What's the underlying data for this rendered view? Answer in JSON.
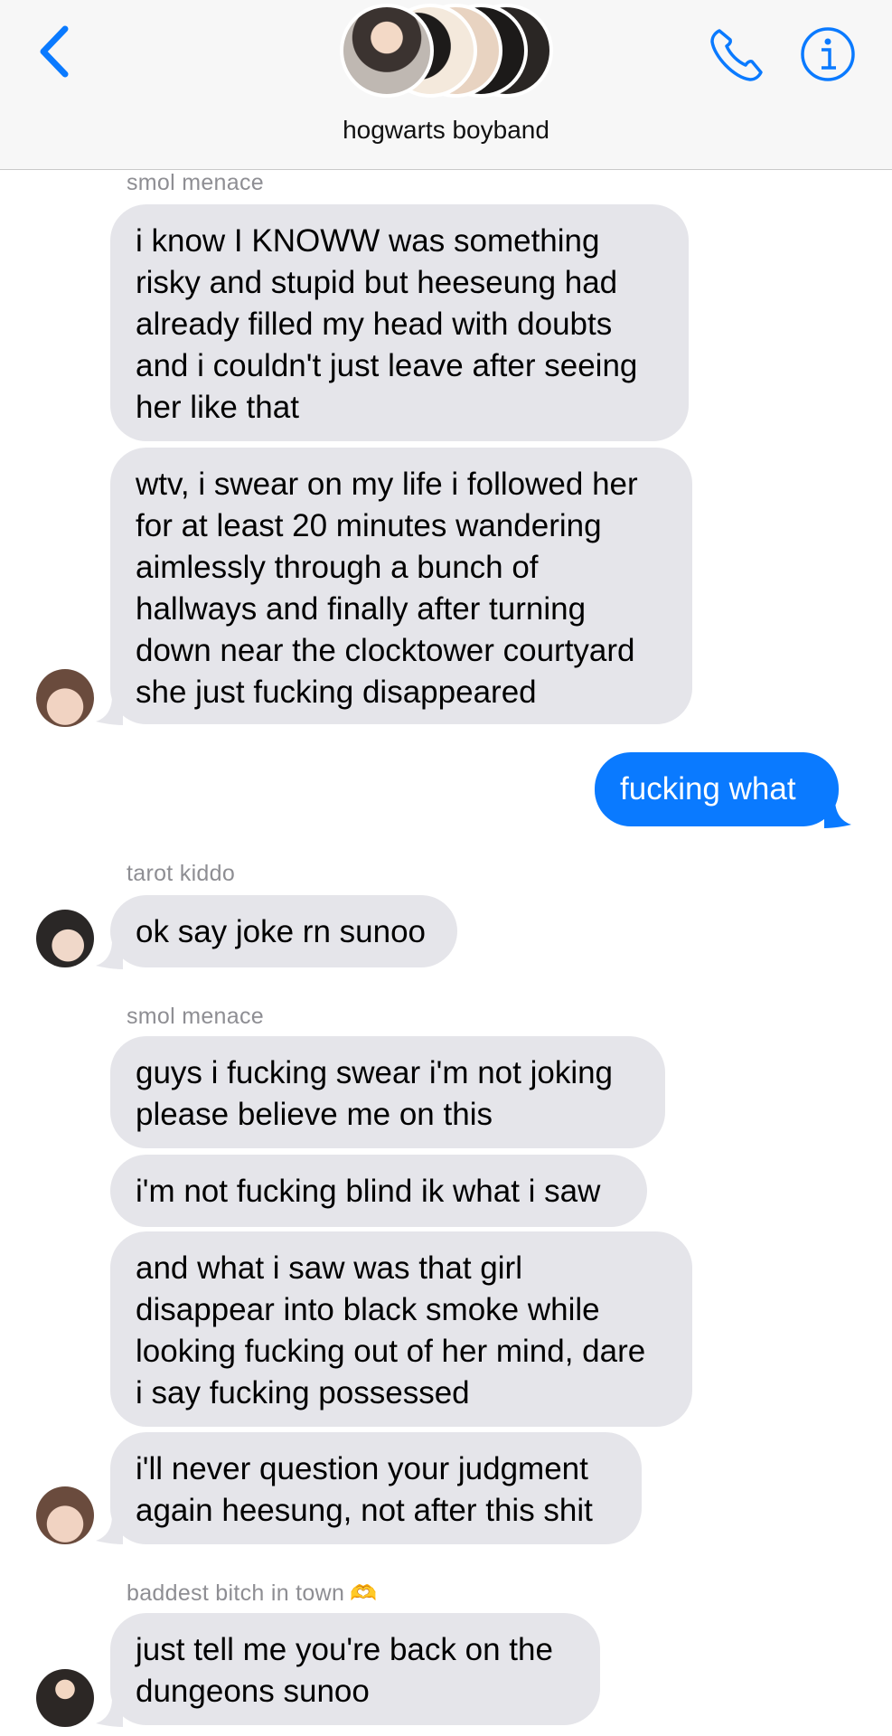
{
  "header": {
    "title": "hogwarts boyband",
    "back_icon": "chevron-left-icon",
    "call_icon": "phone-icon",
    "info_icon": "info-icon",
    "accent": "#0a7aff"
  },
  "messages": {
    "g1": {
      "sender": "smol menace",
      "b1": "i know I KNOWW was something\nrisky and stupid but heeseung had\nalready filled my head with doubts\nand i couldn't just leave after seeing\nher like that",
      "b2": "wtv, i swear on my life i followed her\nfor at least 20 minutes wandering\naimlessly through a bunch of\nhallways and finally after turning\ndown near the clocktower courtyard\nshe just fucking disappeared"
    },
    "out1": "fucking what",
    "g2": {
      "sender": "tarot kiddo",
      "b1": "ok say joke rn sunoo"
    },
    "g3": {
      "sender": "smol menace",
      "b1": "guys i fucking swear i'm not joking\nplease believe me on this",
      "b2": "i'm not fucking blind ik what i saw",
      "b3": "and what i saw was that girl\ndisappear into black smoke while\nlooking fucking out of her mind, dare\ni say fucking possessed",
      "b4": "i'll never question your judgment\nagain heesung, not after this shit"
    },
    "g4": {
      "sender": "baddest bitch in town",
      "sender_emoji": "🫶",
      "b1": "just tell me you're back on the\ndungeons sunoo"
    }
  },
  "colors": {
    "incoming_bubble": "#e5e5ea",
    "outgoing_bubble": "#0a7aff",
    "sender_label": "#8e8e93"
  }
}
